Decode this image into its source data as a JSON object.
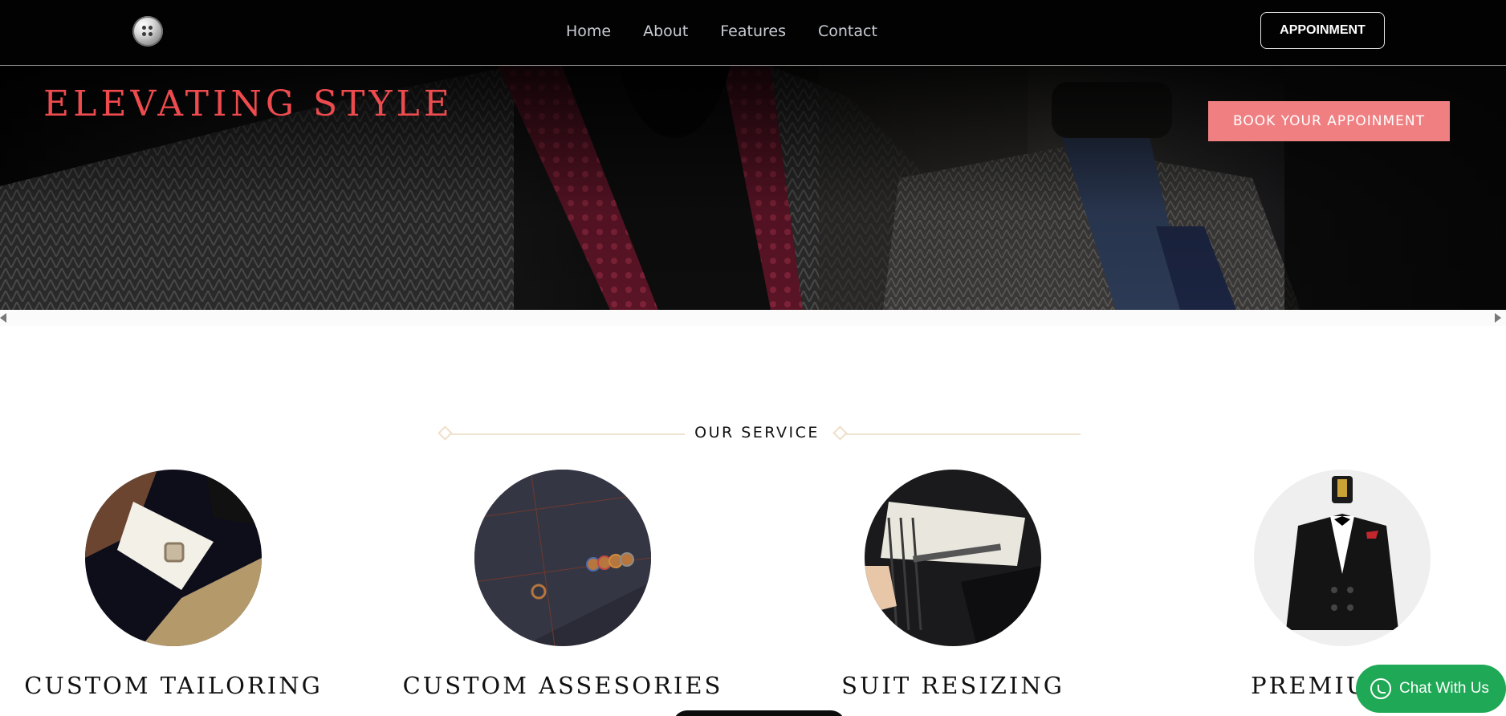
{
  "nav": {
    "links": [
      "Home",
      "About",
      "Features",
      "Contact"
    ],
    "appointment_label": "APPOINMENT"
  },
  "hero": {
    "title": "ELEVATING STYLE",
    "book_label": "BOOK YOUR APPOINMENT"
  },
  "services": {
    "heading": "OUR SERVICE",
    "items": [
      {
        "title": "CUSTOM TAILORING",
        "icon": "cufflink-image"
      },
      {
        "title": "CUSTOM ASSESORIES",
        "icon": "sleeve-buttons-image"
      },
      {
        "title": "SUIT RESIZING",
        "icon": "suit-lining-image"
      },
      {
        "title": "PREMIUM LI",
        "icon": "tuxedo-mannequin-image"
      }
    ]
  },
  "chat": {
    "label": "Chat With Us",
    "icon": "whatsapp-icon"
  },
  "colors": {
    "accent_red": "#ee4b4f",
    "book_button": "#f07f82",
    "chat_green": "#1fa855",
    "nav_bg": "#020202"
  }
}
